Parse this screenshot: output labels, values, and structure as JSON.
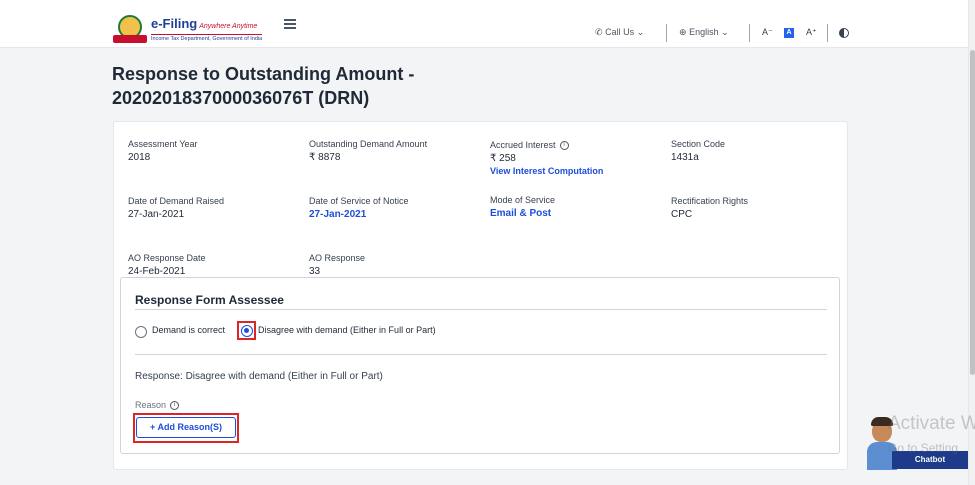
{
  "header": {
    "logo_title": "e-Filing",
    "logo_tagline": "Anywhere Anytime",
    "logo_subtitle": "Income Tax Department, Government of India",
    "call_us": "Call Us",
    "language": "English",
    "font_decrease": "A⁻",
    "font_default": "A",
    "font_increase": "A⁺"
  },
  "page": {
    "title": "Response to Outstanding Amount - 2020201837000036076T (DRN)"
  },
  "details": {
    "assessment_year": {
      "label": "Assessment Year",
      "value": "2018"
    },
    "outstanding_demand": {
      "label": "Outstanding Demand Amount",
      "value": "₹ 8878"
    },
    "accrued_interest": {
      "label": "Accrued Interest",
      "value": "₹ 258",
      "link": "View Interest Computation"
    },
    "section_code": {
      "label": "Section Code",
      "value": "1431a"
    },
    "date_demand_raised": {
      "label": "Date of Demand Raised",
      "value": "27-Jan-2021"
    },
    "date_service_notice": {
      "label": "Date of Service of Notice",
      "value": "27-Jan-2021"
    },
    "mode_of_service": {
      "label": "Mode of Service",
      "value": "Email & Post"
    },
    "rectification_rights": {
      "label": "Rectification Rights",
      "value": "CPC"
    },
    "ao_response_date": {
      "label": "AO Response Date",
      "value": "24-Feb-2021"
    },
    "ao_response": {
      "label": "AO Response",
      "value": "33"
    }
  },
  "form": {
    "title": "Response Form Assessee",
    "options": [
      {
        "label": "Demand is correct",
        "selected": false
      },
      {
        "label": "Disagree with demand (Either in Full or Part)",
        "selected": true
      }
    ],
    "response_text": "Response: Disagree with demand (Either in Full or Part)",
    "reason_label": "Reason",
    "add_reason_button": "+ Add Reason(S)"
  },
  "chatbot": {
    "label": "Chatbot"
  },
  "watermark": {
    "line1": "Activate W",
    "line2": "Go to Setting"
  },
  "colors": {
    "brand_blue": "#1d4ed8",
    "highlight_red": "#dc2626",
    "chatbot_bg": "#1e3a8a"
  },
  "icons": [
    "emblem-icon",
    "hamburger-menu-icon",
    "phone-icon",
    "globe-icon",
    "chevron-down-icon",
    "info-icon",
    "contrast-icon"
  ]
}
